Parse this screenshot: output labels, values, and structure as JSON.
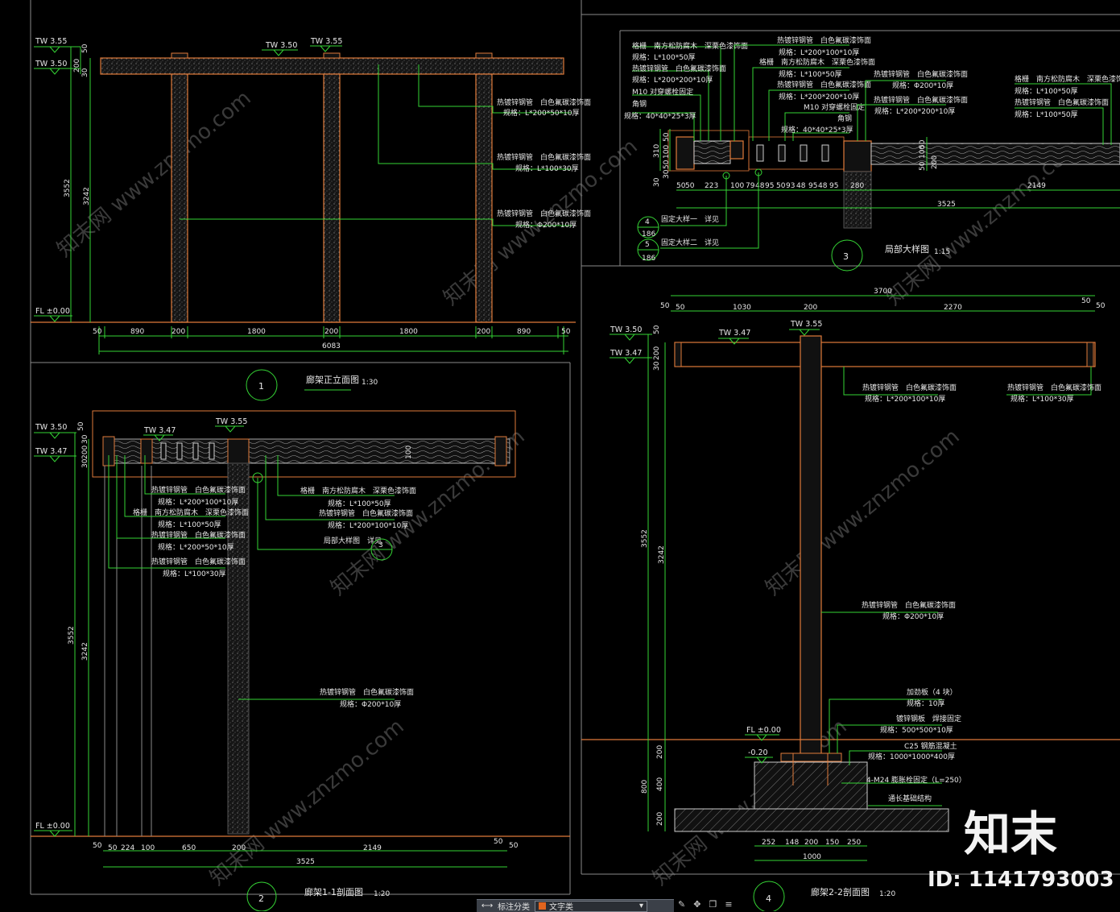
{
  "elevation1": {
    "title": "廊架正立面图",
    "scale": "1:30",
    "number": "1",
    "levels": [
      "TW 3.55",
      "TW 3.50",
      "TW 3.50",
      "TW 3.55",
      "FL ±0.00"
    ],
    "dims_top": [
      "50",
      "890",
      "200",
      "1800",
      "200",
      "1800",
      "200",
      "890",
      "50"
    ],
    "dim_total": "6083",
    "dims_left": [
      "3552",
      "3242",
      "200",
      "50",
      "30"
    ],
    "notes": [
      {
        "line1": "热镀锌钢管　白色氟碳漆饰面",
        "line2": "规格：L*200*50*10厚"
      },
      {
        "line1": "热镀锌钢管　白色氟碳漆饰面",
        "line2": "规格：L*100*30厚"
      },
      {
        "line1": "热镀锌钢管　白色氟碳漆饰面",
        "line2": "规格：Φ200*10厚"
      }
    ]
  },
  "section11": {
    "title": "廊架1-1剖面图",
    "scale": "1:20",
    "number": "2",
    "levels": [
      "TW 3.50",
      "TW 3.47",
      "TW 3.47",
      "TW 3.55",
      "FL ±0.00"
    ],
    "dims_bottom": [
      "50",
      "50",
      "224",
      "100",
      "650",
      "200",
      "2149",
      "50"
    ],
    "dim_total": "3525",
    "dims_left": [
      "3552",
      "3242",
      "50",
      "30",
      "200",
      "30"
    ],
    "notes": [
      {
        "line1": "热镀锌钢管　白色氟碳漆饰面",
        "line2": "规格：L*200*100*10厚"
      },
      {
        "line1": "格栅　南方松防腐木　深栗色漆饰面",
        "line2": "规格：L*100*50厚"
      },
      {
        "line1": "热镀锌钢管　白色氟碳漆饰面",
        "line2": "规格：L*200*50*10厚"
      },
      {
        "line1": "热镀锌钢管　白色氟碳漆饰面",
        "line2": "规格：L*100*30厚"
      },
      {
        "line1": "格栅　南方松防腐木　深栗色漆饰面",
        "line2": "规格：L*100*50厚"
      },
      {
        "line1": "热镀锌钢管　白色氟碳漆饰面",
        "line2": "规格：L*200*100*10厚"
      },
      {
        "line1": "局部大样图　详见",
        "line2": ""
      },
      {
        "line1": "热镀锌钢管　白色氟碳漆饰面",
        "line2": "规格：Φ200*10厚"
      }
    ],
    "callout": "3"
  },
  "detail3": {
    "title": "局部大样图",
    "scale": "1:15",
    "number": "3",
    "notes_left": [
      {
        "line1": "格栅　南方松防腐木　深栗色漆饰面",
        "line2": "规格：L*100*50厚"
      },
      {
        "line1": "热镀锌钢管　白色氟碳漆饰面",
        "line2": "规格：L*200*200*10厚"
      },
      {
        "line1": "M10 对穿螺栓固定",
        "line2": ""
      },
      {
        "line1": "角钢",
        "line2": "规格：40*40*25*3厚"
      }
    ],
    "notes_mid": [
      {
        "line1": "热镀锌钢管　白色氟碳漆饰面",
        "line2": "规格：L*200*100*10厚"
      },
      {
        "line1": "格栅　南方松防腐木　深栗色漆饰面",
        "line2": "规格：L*100*50厚"
      },
      {
        "line1": "热镀锌钢管　白色氟碳漆饰面",
        "line2": "规格：L*200*200*10厚"
      },
      {
        "line1": "M10 对穿螺栓固定",
        "line2": ""
      },
      {
        "line1": "角钢",
        "line2": "规格：40*40*25*3厚"
      }
    ],
    "notes_right1": [
      {
        "line1": "热镀锌钢管　白色氟碳漆饰面",
        "line2": "规格：Φ200*10厚"
      },
      {
        "line1": "热镀锌钢管　白色氟碳漆饰面",
        "line2": "规格：L*200*200*10厚"
      }
    ],
    "notes_right2": [
      {
        "line1": "格栅　南方松防腐木　深栗色漆饰面",
        "line2": "规格：L*100*50厚"
      },
      {
        "line1": "热镀锌钢管　白色氟碳漆饰面",
        "line2": "规格：L*100*50厚"
      }
    ],
    "dims_bottom": [
      "50",
      "50",
      "223",
      "100",
      "79",
      "48",
      "95",
      "50",
      "93",
      "48",
      "95",
      "48",
      "95",
      "280",
      "2149"
    ],
    "dim_total": "3525",
    "dims_left": [
      "310",
      "30",
      "50",
      "100",
      "50",
      "30"
    ],
    "dims_right": [
      "50",
      "100",
      "50",
      "200"
    ],
    "refs": [
      {
        "num": "4",
        "sheet": "186",
        "text": "固定大样一　详见"
      },
      {
        "num": "5",
        "sheet": "186",
        "text": "固定大样二　详见"
      }
    ]
  },
  "section22": {
    "title": "廊架2-2剖面图",
    "scale": "1:20",
    "number": "4",
    "levels": [
      "TW 3.50",
      "TW 3.47",
      "TW 3.47",
      "TW 3.55",
      "FL ±0.00",
      "-0.20"
    ],
    "dims_top": [
      "50",
      "50",
      "1030",
      "200",
      "2270",
      "50",
      "50"
    ],
    "dim_total": "3700",
    "dims_left": [
      "50",
      "200",
      "30",
      "3552",
      "3242",
      "200",
      "400",
      "800",
      "200"
    ],
    "dims_bottom": [
      "252",
      "148",
      "200",
      "150",
      "250"
    ],
    "dim_bottom_total": "1000",
    "notes": [
      {
        "line1": "热镀锌钢管　白色氟碳漆饰面",
        "line2": "规格：L*200*100*10厚"
      },
      {
        "line1": "热镀锌钢管　白色氟碳漆饰面",
        "line2": "规格：L*100*30厚"
      },
      {
        "line1": "热镀锌钢管　白色氟碳漆饰面",
        "line2": "规格：Φ200*10厚"
      },
      {
        "line1": "加劲板（4 块）",
        "line2": "规格：10厚"
      },
      {
        "line1": "镀锌钢板　焊接固定",
        "line2": "规格：500*500*10厚"
      },
      {
        "line1": "C25 钢筋混凝土",
        "line2": "规格：1000*1000*400厚"
      },
      {
        "line1": "4-M24 膨胀栓固定（L=250）",
        "line2": ""
      },
      {
        "line1": "通长基础结构",
        "line2": ""
      }
    ]
  },
  "watermark": {
    "logo": "知末",
    "id": "ID: 1141793003",
    "site": "知末网 www.znzmo.com"
  },
  "toolbar": {
    "label1": "标注分类",
    "layer": "文字类"
  },
  "colors": {
    "line": "#35d435",
    "outline": "#e07a3a",
    "text": "#e8e8e8",
    "bg": "#000000"
  }
}
